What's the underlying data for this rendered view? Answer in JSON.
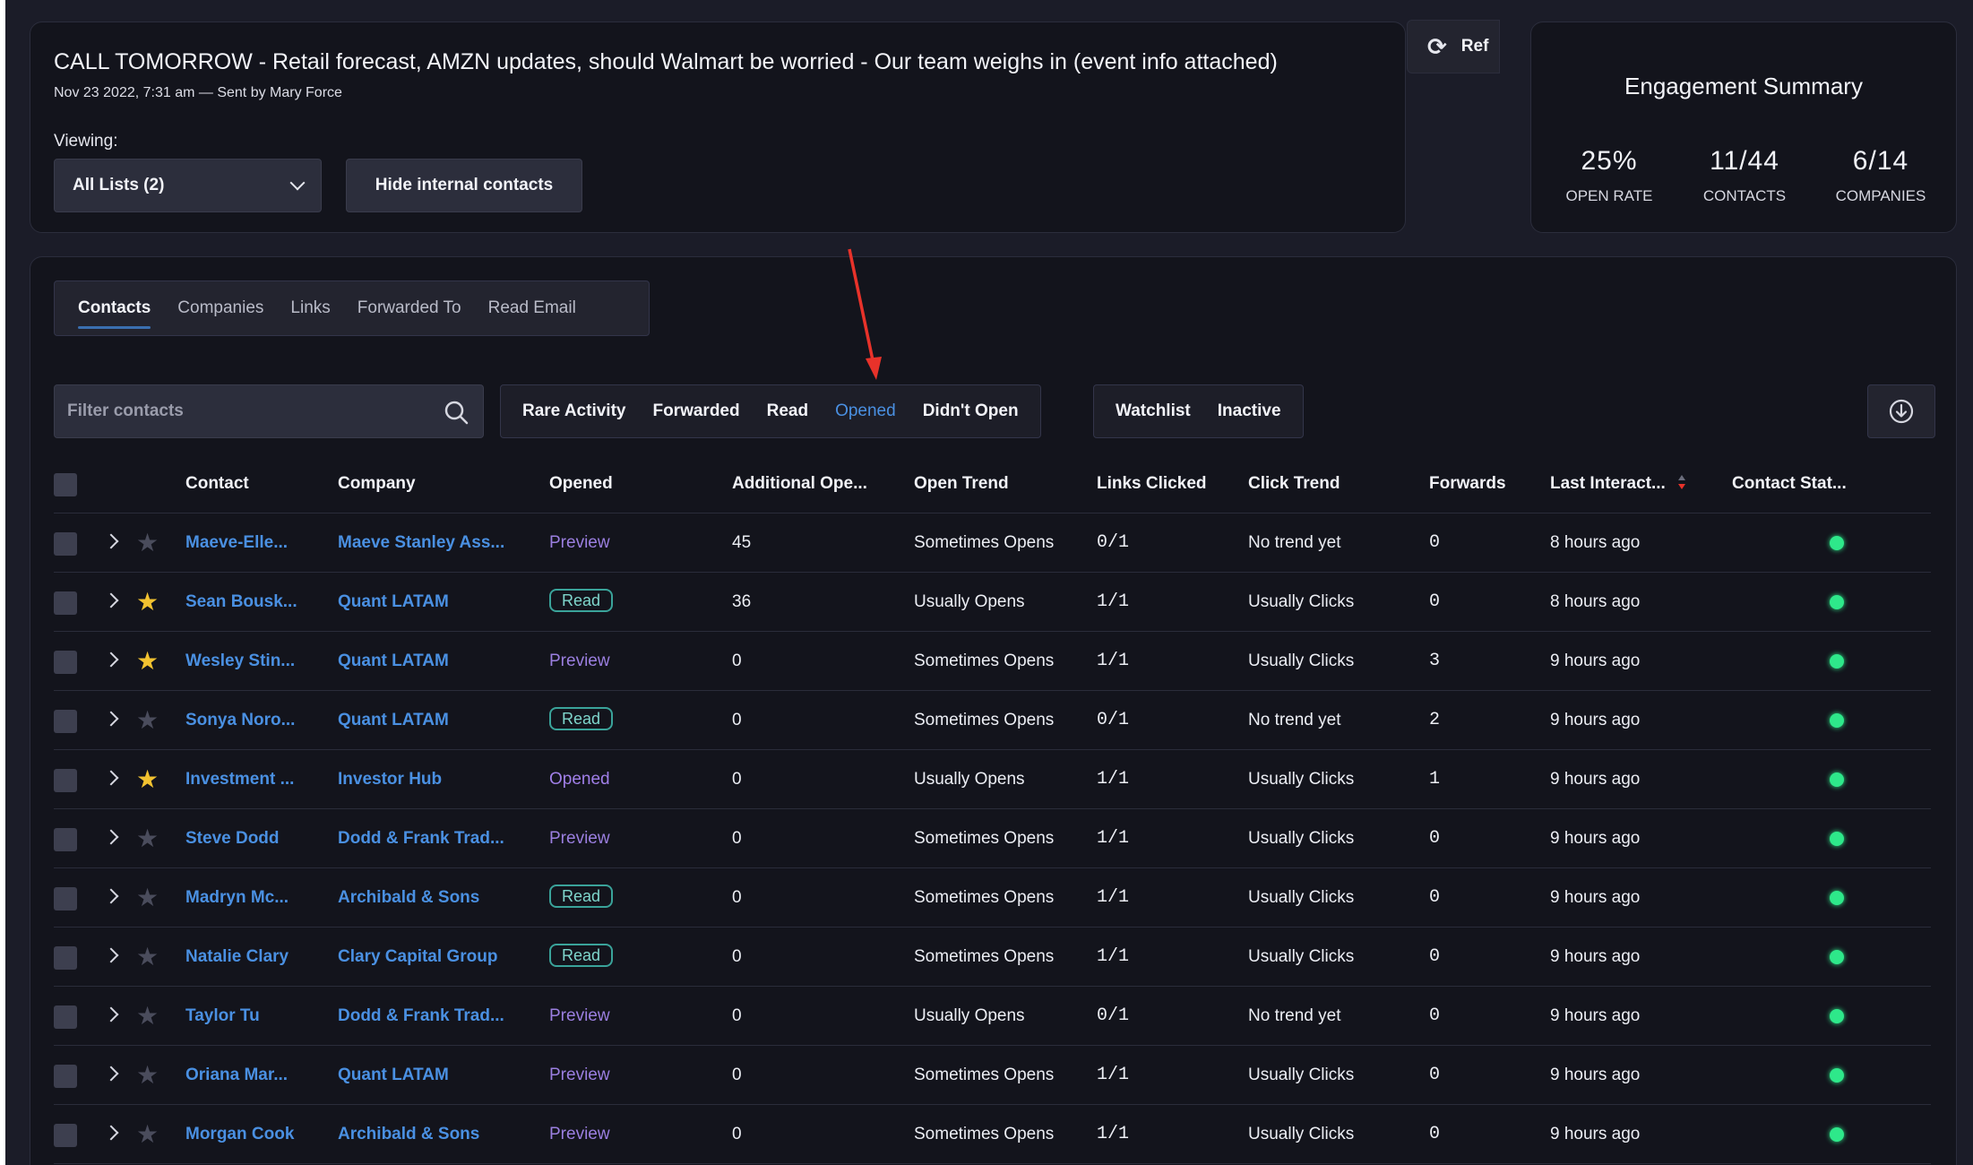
{
  "email": {
    "subject": "CALL TOMORROW - Retail forecast, AMZN updates, should Walmart be worried - Our team weighs in (event info attached)",
    "meta": "Nov 23 2022, 7:31 am — Sent by Mary Force",
    "viewing_label": "Viewing:",
    "list_select": "All Lists (2)",
    "hide_internal": "Hide internal contacts"
  },
  "refresh": {
    "label": "Ref"
  },
  "summary": {
    "title": "Engagement Summary",
    "stats": [
      {
        "value": "25%",
        "label": "OPEN RATE"
      },
      {
        "value": "11/44",
        "label": "CONTACTS"
      },
      {
        "value": "6/14",
        "label": "COMPANIES"
      }
    ]
  },
  "tabs": [
    "Contacts",
    "Companies",
    "Links",
    "Forwarded To",
    "Read Email"
  ],
  "filter": {
    "placeholder": "Filter contacts"
  },
  "activity_filters": [
    "Rare Activity",
    "Forwarded",
    "Read",
    "Opened",
    "Didn't Open"
  ],
  "status_filters": [
    "Watchlist",
    "Inactive"
  ],
  "columns": [
    "Contact",
    "Company",
    "Opened",
    "Additional Ope...",
    "Open Trend",
    "Links Clicked",
    "Click Trend",
    "Forwards",
    "Last Interact...",
    "Contact Stat..."
  ],
  "colors": {
    "accent": "#4a90e2",
    "status_active": "#2ee88a",
    "star": "#f2c230",
    "annotation": "#e8322a"
  },
  "rows": [
    {
      "contact": "Maeve-Elle...",
      "company": "Maeve Stanley Ass...",
      "opened": "Preview",
      "additional": "45",
      "open_trend": "Sometimes Opens",
      "links": "0/1",
      "click_trend": "No trend yet",
      "forwards": "0",
      "last": "8 hours ago",
      "starred": false
    },
    {
      "contact": "Sean Bousk...",
      "company": "Quant LATAM",
      "opened": "Read",
      "additional": "36",
      "open_trend": "Usually Opens",
      "links": "1/1",
      "click_trend": "Usually Clicks",
      "forwards": "0",
      "last": "8 hours ago",
      "starred": true
    },
    {
      "contact": "Wesley Stin...",
      "company": "Quant LATAM",
      "opened": "Preview",
      "additional": "0",
      "open_trend": "Sometimes Opens",
      "links": "1/1",
      "click_trend": "Usually Clicks",
      "forwards": "3",
      "last": "9 hours ago",
      "starred": true
    },
    {
      "contact": "Sonya Noro...",
      "company": "Quant LATAM",
      "opened": "Read",
      "additional": "0",
      "open_trend": "Sometimes Opens",
      "links": "0/1",
      "click_trend": "No trend yet",
      "forwards": "2",
      "last": "9 hours ago",
      "starred": false
    },
    {
      "contact": "Investment ...",
      "company": "Investor Hub",
      "opened": "Opened",
      "additional": "0",
      "open_trend": "Usually Opens",
      "links": "1/1",
      "click_trend": "Usually Clicks",
      "forwards": "1",
      "last": "9 hours ago",
      "starred": true
    },
    {
      "contact": "Steve Dodd",
      "company": "Dodd & Frank Trad...",
      "opened": "Preview",
      "additional": "0",
      "open_trend": "Sometimes Opens",
      "links": "1/1",
      "click_trend": "Usually Clicks",
      "forwards": "0",
      "last": "9 hours ago",
      "starred": false
    },
    {
      "contact": "Madryn Mc...",
      "company": "Archibald & Sons",
      "opened": "Read",
      "additional": "0",
      "open_trend": "Sometimes Opens",
      "links": "1/1",
      "click_trend": "Usually Clicks",
      "forwards": "0",
      "last": "9 hours ago",
      "starred": false
    },
    {
      "contact": "Natalie Clary",
      "company": "Clary Capital Group",
      "opened": "Read",
      "additional": "0",
      "open_trend": "Sometimes Opens",
      "links": "1/1",
      "click_trend": "Usually Clicks",
      "forwards": "0",
      "last": "9 hours ago",
      "starred": false
    },
    {
      "contact": "Taylor Tu",
      "company": "Dodd & Frank Trad...",
      "opened": "Preview",
      "additional": "0",
      "open_trend": "Usually Opens",
      "links": "0/1",
      "click_trend": "No trend yet",
      "forwards": "0",
      "last": "9 hours ago",
      "starred": false
    },
    {
      "contact": "Oriana Mar...",
      "company": "Quant LATAM",
      "opened": "Preview",
      "additional": "0",
      "open_trend": "Sometimes Opens",
      "links": "1/1",
      "click_trend": "Usually Clicks",
      "forwards": "0",
      "last": "9 hours ago",
      "starred": false
    },
    {
      "contact": "Morgan Cook",
      "company": "Archibald & Sons",
      "opened": "Preview",
      "additional": "0",
      "open_trend": "Sometimes Opens",
      "links": "1/1",
      "click_trend": "Usually Clicks",
      "forwards": "0",
      "last": "9 hours ago",
      "starred": false
    }
  ]
}
